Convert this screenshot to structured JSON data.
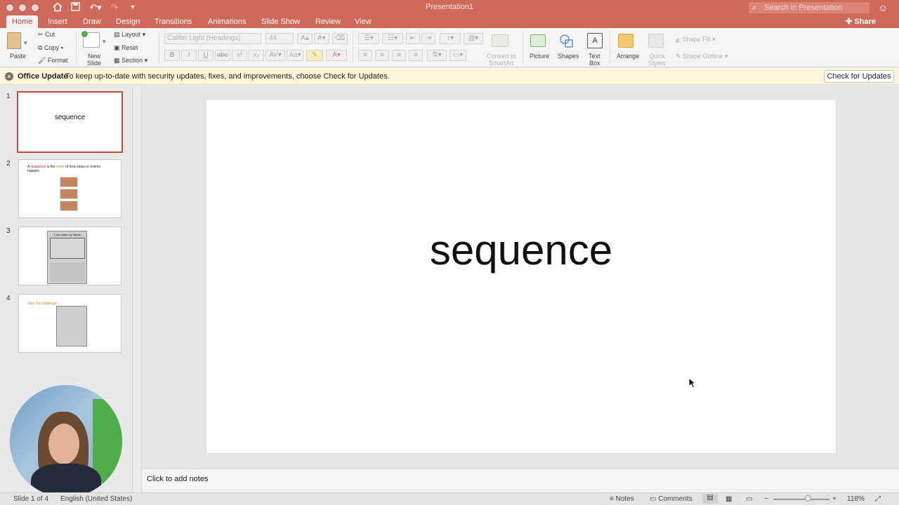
{
  "titlebar": {
    "title": "Presentation1",
    "search_placeholder": "Search in Presentation"
  },
  "tabs": [
    {
      "label": "Home",
      "active": true
    },
    {
      "label": "Insert"
    },
    {
      "label": "Draw"
    },
    {
      "label": "Design"
    },
    {
      "label": "Transitions"
    },
    {
      "label": "Animations"
    },
    {
      "label": "Slide Show"
    },
    {
      "label": "Review"
    },
    {
      "label": "View"
    }
  ],
  "share_label": "Share",
  "ribbon": {
    "paste": "Paste",
    "cut": "Cut",
    "copy": "Copy",
    "format": "Format",
    "new_slide_1": "New",
    "new_slide_2": "Slide",
    "layout": "Layout",
    "reset": "Reset",
    "section": "Section",
    "font_name": "Calibri Light (Headings)",
    "font_size": "44",
    "convert_1": "Convert to",
    "convert_2": "SmartArt",
    "picture": "Picture",
    "shapes": "Shapes",
    "text_box_1": "Text",
    "text_box_2": "Box",
    "arrange": "Arrange",
    "quick_styles_1": "Quick",
    "quick_styles_2": "Styles",
    "shape_fill": "Shape Fill",
    "shape_outline": "Shape Outline"
  },
  "update_bar": {
    "title": "Office Update",
    "message": "To keep up-to-date with security updates, fixes, and improvements, choose Check for Updates.",
    "button": "Check for Updates"
  },
  "slides": [
    {
      "number": "1",
      "text": "sequence"
    },
    {
      "number": "2",
      "text_a": "A ",
      "text_b": "sequence",
      "text_c": " is the ",
      "text_d": "order",
      "text_e": " of how steps or events happen."
    },
    {
      "number": "3",
      "text": "I can wash my hands."
    },
    {
      "number": "4",
      "text": "Take the challenge!"
    }
  ],
  "current_slide": {
    "title": "sequence"
  },
  "notes_placeholder": "Click to add notes",
  "status": {
    "slide_of": "Slide 1 of 4",
    "language": "English (United States)",
    "notes": "Notes",
    "comments": "Comments",
    "zoom": "118%",
    "zoom_fraction": 0.62
  },
  "colors": {
    "accent": "#cf6a5a",
    "active_tab_text": "#c6493a",
    "selected_thumb_border": "#c6493a"
  }
}
